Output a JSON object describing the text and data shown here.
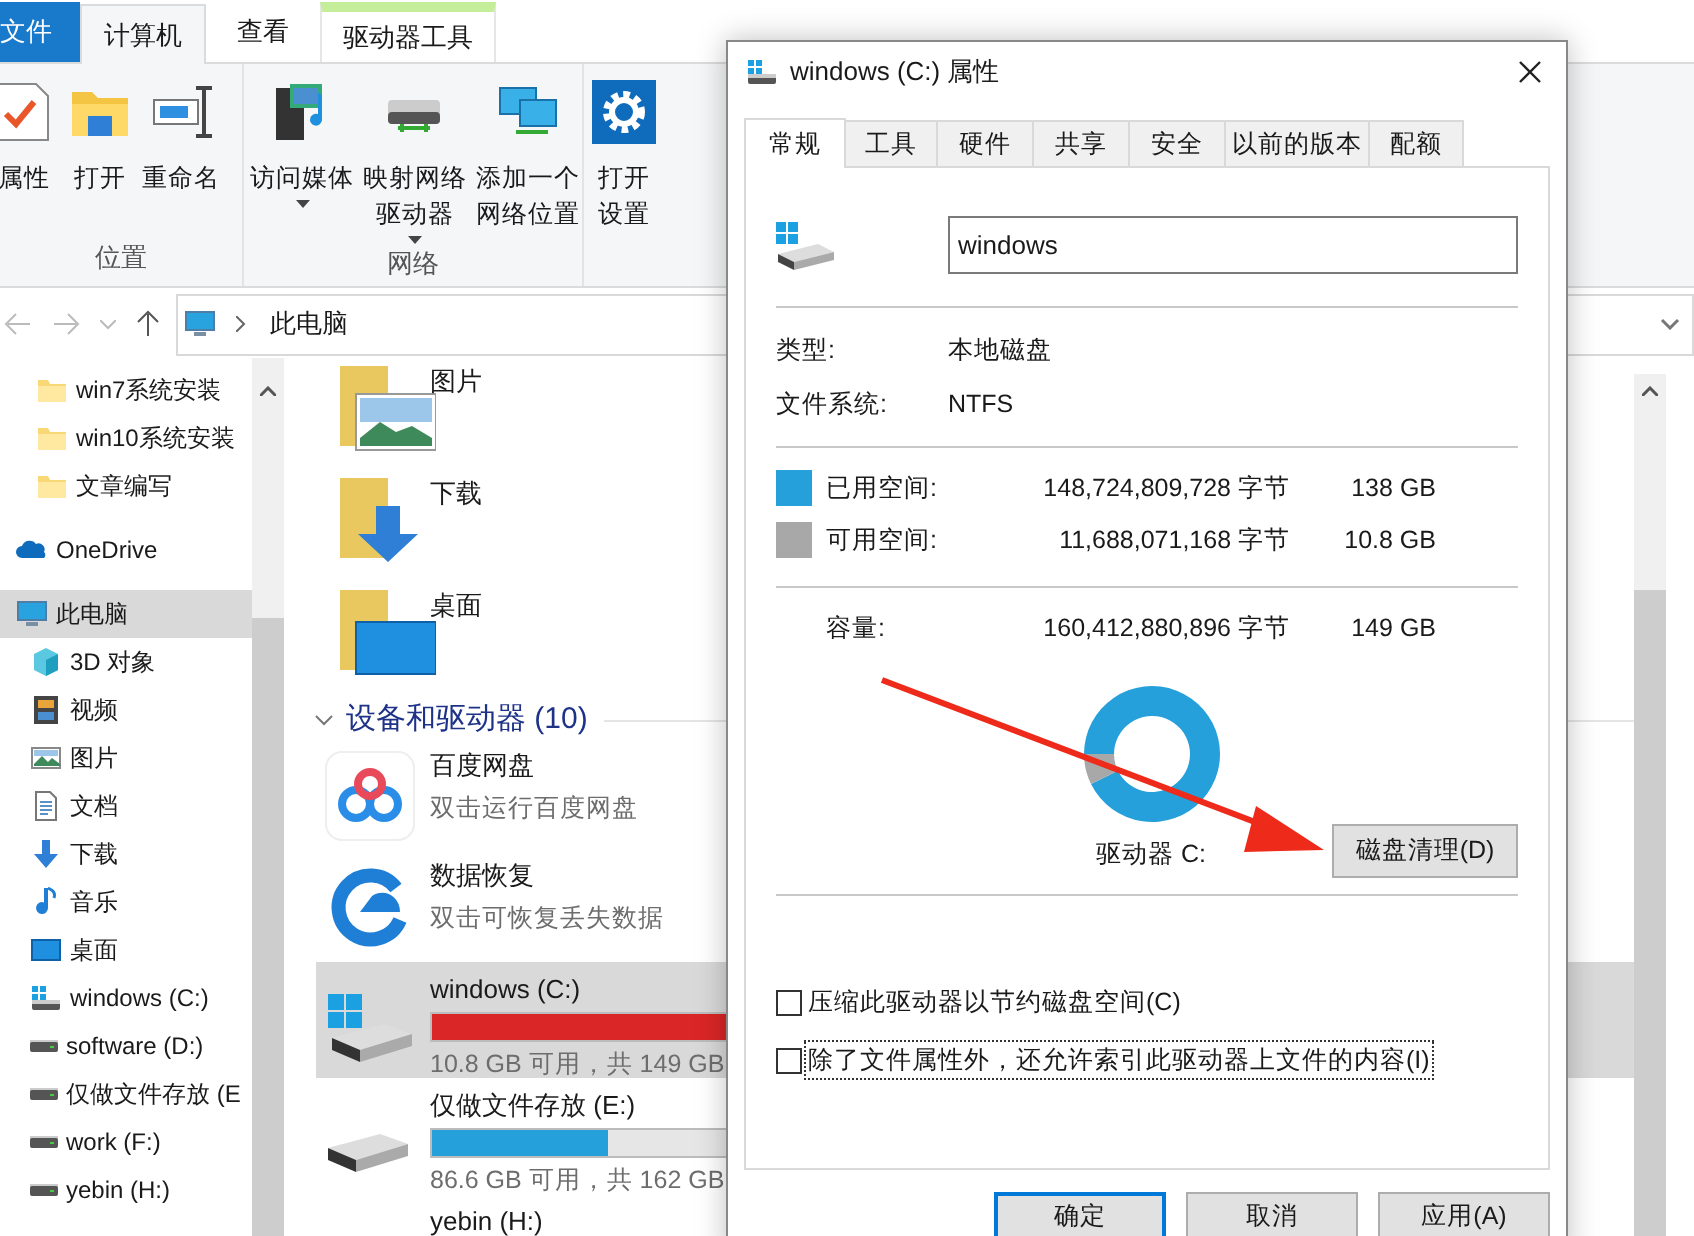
{
  "explorer": {
    "ribbon_tabs": [
      {
        "label": "文件",
        "kind": "file",
        "selected": false
      },
      {
        "label": "计算机",
        "kind": "tab",
        "selected": true
      },
      {
        "label": "查看",
        "kind": "tab",
        "selected": false
      },
      {
        "label": "驱动器工具",
        "kind": "context",
        "selected": false
      }
    ],
    "ribbon_groups": [
      {
        "label": "位置",
        "buttons": [
          {
            "label": "属性",
            "kind": "properties",
            "dropdown": false
          },
          {
            "label": "打开",
            "kind": "open",
            "dropdown": false
          },
          {
            "label": "重命名",
            "kind": "rename",
            "dropdown": false
          }
        ]
      },
      {
        "label": "网络",
        "buttons": [
          {
            "label": "访问媒体",
            "kind": "media",
            "dropdown": true
          },
          {
            "label": "映射网络驱动器",
            "kind": "map_drive",
            "dropdown": true
          },
          {
            "label": "添加一个网络位置",
            "kind": "network_location",
            "dropdown": false
          }
        ]
      },
      {
        "buttons": [
          {
            "label": "打开设置",
            "kind": "settings",
            "dropdown": false
          }
        ]
      }
    ],
    "address_path": "此电脑",
    "quick_access_items": [
      {
        "label": "win7系统安装",
        "kind": "folder",
        "selected": false
      },
      {
        "label": "win10系统安装",
        "kind": "folder",
        "selected": false
      },
      {
        "label": "文章编写",
        "kind": "folder",
        "selected": false
      }
    ],
    "nav_tree": [
      {
        "label": "OneDrive",
        "kind": "cloud",
        "selected": false
      },
      {
        "label": "此电脑",
        "kind": "pc",
        "selected": true,
        "children": [
          {
            "label": "3D 对象",
            "kind": "cube",
            "selected": false
          },
          {
            "label": "视频",
            "kind": "video",
            "selected": false
          },
          {
            "label": "图片",
            "kind": "pictures",
            "selected": false
          },
          {
            "label": "文档",
            "kind": "documents",
            "selected": false
          },
          {
            "label": "下载",
            "kind": "downloads",
            "selected": false
          },
          {
            "label": "音乐",
            "kind": "music",
            "selected": false
          },
          {
            "label": "桌面",
            "kind": "desktop",
            "selected": false
          },
          {
            "label": "windows (C:)",
            "kind": "drive_windows",
            "selected": false
          },
          {
            "label": "software (D:)",
            "kind": "drive",
            "selected": false
          },
          {
            "label": "仅做文件存放 (E",
            "kind": "drive",
            "selected": false
          },
          {
            "label": "work (F:)",
            "kind": "drive",
            "selected": false
          },
          {
            "label": "yebin (H:)",
            "kind": "drive",
            "selected": false
          }
        ]
      }
    ],
    "folders": [
      {
        "label": "图片",
        "kind": "pictures"
      },
      {
        "label": "下载",
        "kind": "downloads"
      },
      {
        "label": "桌面",
        "kind": "desktop"
      }
    ],
    "devices_header": "设备和驱动器 (10)",
    "devices": [
      {
        "kind": "app_cloud",
        "name": "百度网盘",
        "subtitle": "双击运行百度网盘",
        "selected": false
      },
      {
        "kind": "app_recovery",
        "name": "数据恢复",
        "subtitle": "双击可恢复丢失数据",
        "selected": false
      },
      {
        "kind": "drive_windows",
        "name": "windows (C:)",
        "level": 0.93,
        "free_text": "10.8 GB 可用，共 149 GB",
        "selected": true
      },
      {
        "kind": "drive",
        "name": "仅做文件存放 (E:)",
        "level": 0.47,
        "free_text": "86.6 GB 可用，共 162 GB",
        "selected": false
      },
      {
        "kind": "drive_name_only",
        "name": "yebin (H:)",
        "selected": false
      }
    ]
  },
  "dialog": {
    "title": "windows (C:) 属性",
    "tabs": [
      {
        "label": "常规",
        "selected": true
      },
      {
        "label": "工具",
        "selected": false
      },
      {
        "label": "硬件",
        "selected": false
      },
      {
        "label": "共享",
        "selected": false
      },
      {
        "label": "安全",
        "selected": false
      },
      {
        "label": "以前的版本",
        "selected": false
      },
      {
        "label": "配额",
        "selected": false
      }
    ],
    "name_value": "windows",
    "info_rows": [
      {
        "label": "类型:",
        "value": "本地磁盘"
      },
      {
        "label": "文件系统:",
        "value": "NTFS"
      }
    ],
    "space_rows": [
      {
        "label": "已用空间:",
        "bytes": "148,724,809,728 字节",
        "size": "138 GB",
        "color": "#26a0da"
      },
      {
        "label": "可用空间:",
        "bytes": "11,688,071,168 字节",
        "size": "10.8 GB",
        "color": "#a8a8a8"
      }
    ],
    "capacity": {
      "label": "容量:",
      "bytes": "160,412,880,896 字节",
      "size": "149 GB"
    },
    "donut": {
      "chart_data": {
        "type": "donut",
        "values": [
          92.7,
          7.3
        ]
      }
    },
    "drive_label": "驱动器 C:",
    "cleanup_button": "磁盘清理(D)",
    "options": [
      {
        "label": "压缩此驱动器以节约磁盘空间(C)",
        "checked": false,
        "focused": false
      },
      {
        "label": "除了文件属性外，还允许索引此驱动器上文件的内容(I)",
        "checked": false,
        "focused": true
      }
    ],
    "buttons": [
      {
        "label": "确定",
        "default": true
      },
      {
        "label": "取消",
        "default": false
      },
      {
        "label": "应用(A)",
        "default": false
      }
    ]
  },
  "arrow_annotation": true
}
